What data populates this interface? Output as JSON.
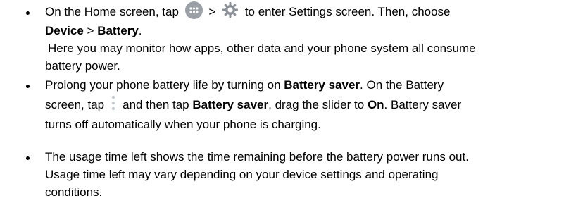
{
  "items": [
    {
      "l1_a": "On the Home screen, tap",
      "l1_sep": ">",
      "l1_b": "to enter Settings screen. Then, choose",
      "l2_bold1": "Device",
      "l2_sep": " > ",
      "l2_bold2": "Battery",
      "l2_end": ".",
      "note_l1": "Here you may monitor how apps, other data and your phone system all consume",
      "note_l2": "battery power."
    },
    {
      "l1_a": "Prolong your phone battery life by turning on ",
      "l1_bold": "Battery saver",
      "l1_b": ". On the Battery",
      "l2_a": "screen, tap",
      "l2_b": "and then tap ",
      "l2_bold1": "Battery saver",
      "l2_c": ", drag the slider to ",
      "l2_bold2": "On",
      "l2_d": ". Battery saver",
      "l3": "turns off automatically when your phone is charging."
    },
    {
      "l1": "The usage time left shows the time remaining before the battery power runs out.",
      "l2": "Usage time left may vary depending on your device settings and operating",
      "l3": "conditions."
    }
  ],
  "icons": {
    "apps": "apps-icon",
    "settings": "gear-icon",
    "menu": "more-vertical-icon"
  }
}
